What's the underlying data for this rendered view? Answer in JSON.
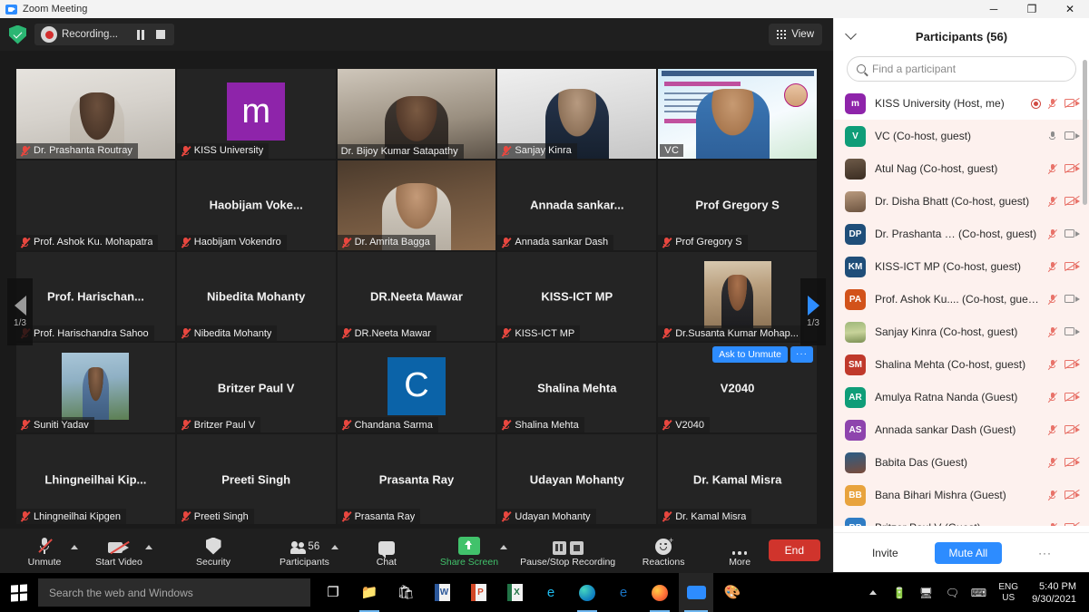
{
  "window": {
    "title": "Zoom Meeting",
    "minimize": "─",
    "maximize": "❐",
    "close": "✕"
  },
  "topbar": {
    "recording_label": "Recording...",
    "view_label": "View"
  },
  "grid": {
    "page_indicator": "1/3",
    "ask_to_unmute": "Ask to Unmute",
    "ask_more": "···",
    "vc_badge": "VC",
    "tiles": [
      {
        "name": "Dr. Prashanta Routray",
        "label": "Dr. Prashanta Routray",
        "muted": true,
        "kind": "video",
        "style": "cam-a"
      },
      {
        "name": "KISS University",
        "label": "KISS University",
        "muted": true,
        "kind": "letter",
        "letter": "m",
        "color": "#8e24aa"
      },
      {
        "name": "Dr. Bijoy Kumar Satapathy",
        "label": "Dr. Bijoy Kumar Satapathy",
        "muted": false,
        "kind": "video",
        "style": "cam-b"
      },
      {
        "name": "Sanjay Kinra",
        "label": "Sanjay Kinra",
        "muted": true,
        "kind": "video",
        "style": "cam-c"
      },
      {
        "name": "VC",
        "label": "",
        "muted": false,
        "kind": "poster",
        "active": true
      },
      {
        "name": "Prof. Ashok Ku. Mohapatra",
        "label": "Prof. Ashok Ku. Mohapatra",
        "muted": true,
        "kind": "blank"
      },
      {
        "name": "Haobijam  Voke...",
        "label": "Haobijam Vokendro",
        "muted": true,
        "kind": "name"
      },
      {
        "name": "Dr. Amrita Bagga",
        "label": "Dr. Amrita Bagga",
        "muted": true,
        "kind": "video",
        "style": "cam-d"
      },
      {
        "name": "Annada  sankar...",
        "label": "Annada sankar Dash",
        "muted": true,
        "kind": "name"
      },
      {
        "name": "Prof Gregory S",
        "label": "Prof Gregory S",
        "muted": true,
        "kind": "name"
      },
      {
        "name": "Prof.  Harischan...",
        "label": "Prof. Harischandra Sahoo",
        "muted": true,
        "kind": "name"
      },
      {
        "name": "Nibedita Mohanty",
        "label": "Nibedita Mohanty",
        "muted": true,
        "kind": "name"
      },
      {
        "name": "DR.Neeta Mawar",
        "label": "DR.Neeta Mawar",
        "muted": true,
        "kind": "name"
      },
      {
        "name": "KISS-ICT MP",
        "label": "KISS-ICT MP",
        "muted": true,
        "kind": "name"
      },
      {
        "name": "Dr.Susanta  Kumar Mohap...",
        "label": "Dr.Susanta  Kumar Mohap...",
        "muted": true,
        "kind": "photo",
        "style": "photo-susanta"
      },
      {
        "name": "Suniti Yadav",
        "label": "Suniti Yadav",
        "muted": true,
        "kind": "photo",
        "style": "photo-suniti"
      },
      {
        "name": "Britzer Paul V",
        "label": "Britzer Paul V",
        "muted": true,
        "kind": "name"
      },
      {
        "name": "Chandana Sarma",
        "label": "Chandana Sarma",
        "muted": true,
        "kind": "letter",
        "letter": "C",
        "color": "#0b63a8"
      },
      {
        "name": "Shalina Mehta",
        "label": "Shalina Mehta",
        "muted": true,
        "kind": "name"
      },
      {
        "name": "V2040",
        "label": "V2040",
        "muted": true,
        "kind": "name",
        "ask_unmute": true
      },
      {
        "name": "Lhingneilhai  Kip...",
        "label": "Lhingneilhai Kipgen",
        "muted": true,
        "kind": "name"
      },
      {
        "name": "Preeti Singh",
        "label": "Preeti Singh",
        "muted": true,
        "kind": "name"
      },
      {
        "name": "Prasanta Ray",
        "label": "Prasanta Ray",
        "muted": true,
        "kind": "name"
      },
      {
        "name": "Udayan Mohanty",
        "label": "Udayan Mohanty",
        "muted": true,
        "kind": "name"
      },
      {
        "name": "Dr. Kamal Misra",
        "label": "Dr. Kamal Misra",
        "muted": true,
        "kind": "name"
      }
    ]
  },
  "toolbar": {
    "unmute": "Unmute",
    "start_video": "Start Video",
    "security": "Security",
    "participants": "Participants",
    "participants_count": "56",
    "chat": "Chat",
    "share_screen": "Share Screen",
    "recording": "Pause/Stop Recording",
    "reactions": "Reactions",
    "more": "More",
    "end": "End"
  },
  "panel": {
    "title": "Participants (56)",
    "search_placeholder": "Find a participant",
    "invite": "Invite",
    "mute_all": "Mute All",
    "more": "···",
    "participants": [
      {
        "name": "KISS University (Host, me)",
        "initials": "m",
        "color": "#8e24aa",
        "mic": "off",
        "cam": "off",
        "recording": true,
        "me": true
      },
      {
        "name": "VC (Co-host, guest)",
        "initials": "V",
        "color": "#0f9d78",
        "mic": "on",
        "cam": "on"
      },
      {
        "name": "Atul Nag (Co-host, guest)",
        "initials": "",
        "photo": "face1",
        "mic": "off",
        "cam": "off"
      },
      {
        "name": "Dr. Disha Bhatt (Co-host, guest)",
        "initials": "",
        "photo": "face2",
        "mic": "off",
        "cam": "off"
      },
      {
        "name": "Dr. Prashanta …  (Co-host, guest)",
        "initials": "DP",
        "color": "#1f4e79",
        "mic": "off",
        "cam": "on"
      },
      {
        "name": "KISS-ICT MP (Co-host, guest)",
        "initials": "KM",
        "color": "#1f4e79",
        "mic": "off",
        "cam": "off"
      },
      {
        "name": "Prof. Ashok Ku.... (Co-host, guest)",
        "initials": "PA",
        "color": "#d2521a",
        "mic": "off",
        "cam": "on"
      },
      {
        "name": "Sanjay Kinra (Co-host, guest)",
        "initials": "",
        "photo": "field",
        "mic": "off",
        "cam": "on"
      },
      {
        "name": "Shalina Mehta (Co-host, guest)",
        "initials": "SM",
        "color": "#c0392b",
        "mic": "off",
        "cam": "off"
      },
      {
        "name": "Amulya Ratna Nanda (Guest)",
        "initials": "AR",
        "color": "#0f9d78",
        "mic": "off",
        "cam": "off"
      },
      {
        "name": "Annada sankar Dash (Guest)",
        "initials": "AS",
        "color": "#8e44ad",
        "mic": "off",
        "cam": "off"
      },
      {
        "name": "Babita Das (Guest)",
        "initials": "",
        "photo": "face3",
        "mic": "off",
        "cam": "off"
      },
      {
        "name": "Bana Bihari Mishra (Guest)",
        "initials": "BB",
        "color": "#e8a33d",
        "mic": "off",
        "cam": "off"
      },
      {
        "name": "Britzer Paul V (Guest)",
        "initials": "BP",
        "color": "#2f7cc4",
        "mic": "off",
        "cam": "off"
      }
    ]
  },
  "taskbar": {
    "search_placeholder": "Search the web and Windows",
    "language": "ENG",
    "region": "US",
    "time": "5:40 PM",
    "date": "9/30/2021",
    "apps": [
      {
        "name": "task-view",
        "glyph": "❐"
      },
      {
        "name": "file-explorer",
        "glyph": "📁"
      },
      {
        "name": "microsoft-store",
        "glyph": "🛍"
      },
      {
        "name": "word",
        "glyph": "W"
      },
      {
        "name": "powerpoint",
        "glyph": "P"
      },
      {
        "name": "excel",
        "glyph": "X"
      },
      {
        "name": "internet-explorer",
        "glyph": "e"
      },
      {
        "name": "edge",
        "glyph": "e"
      },
      {
        "name": "edge-legacy",
        "glyph": "e"
      },
      {
        "name": "firefox",
        "glyph": "●"
      },
      {
        "name": "zoom",
        "glyph": "▶"
      },
      {
        "name": "paint",
        "glyph": "🎨"
      }
    ]
  }
}
